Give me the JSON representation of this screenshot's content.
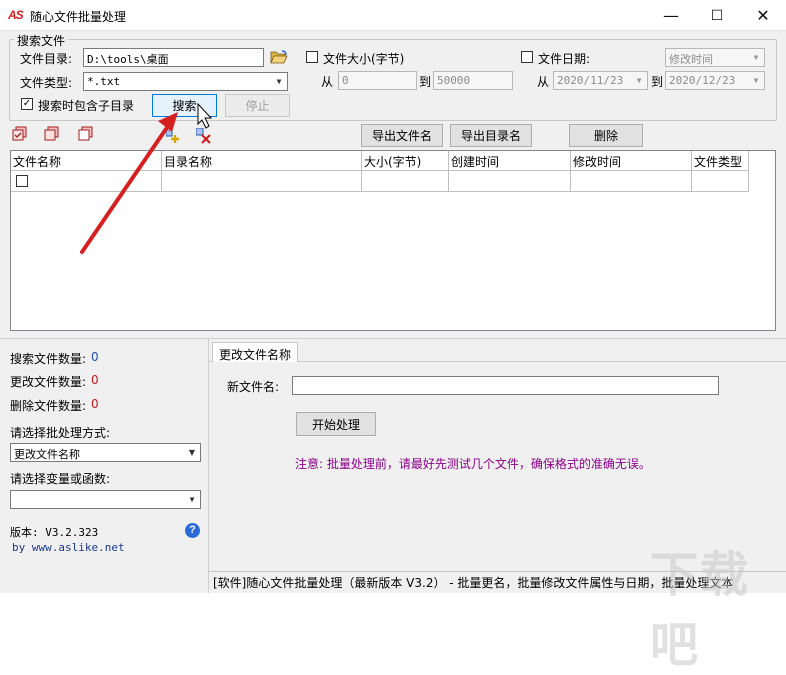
{
  "window": {
    "logo": "AS",
    "title": "随心文件批量处理",
    "minimize_glyph": "—",
    "maximize_glyph": "☐",
    "close_glyph": "✕"
  },
  "search": {
    "group_label": "搜索文件",
    "dir_label": "文件目录:",
    "dir_value": "D:\\tools\\桌面",
    "type_label": "文件类型:",
    "type_value": "*.txt",
    "include_sub_label": "搜索时包含子目录",
    "include_sub_checked": "✓",
    "search_button": "搜索",
    "stop_button": "停止",
    "size_label": "文件大小(字节)",
    "size_from_label": "从",
    "size_from": "0",
    "size_to_label": "到",
    "size_to": "50000",
    "date_label": "文件日期:",
    "date_mode": "修改时间",
    "date_from_label": "从",
    "date_from": "2020/11/23",
    "date_to_label": "到",
    "date_to": "2020/12/23"
  },
  "toolbar": {
    "export_files": "导出文件名",
    "export_dirs": "导出目录名",
    "delete": "删除"
  },
  "table": {
    "columns": [
      "文件名称",
      "目录名称",
      "大小(字节)",
      "创建时间",
      "修改时间",
      "文件类型"
    ]
  },
  "stats": {
    "search_count_label": "搜索文件数量:",
    "search_count": "0",
    "rename_count_label": "更改文件数量:",
    "rename_count": "0",
    "delete_count_label": "删除文件数量:",
    "delete_count": "0",
    "mode_label": "请选择批处理方式:",
    "mode_value": "更改文件名称",
    "var_label": "请选择变量或函数:",
    "var_value": "",
    "version": "版本: V3.2.323",
    "website": "by www.aslike.net",
    "help_glyph": "?"
  },
  "rename": {
    "tab_label": "更改文件名称",
    "new_name_label": "新文件名:",
    "new_name_value": "",
    "start_button": "开始处理",
    "note": "注意: 批量处理前，请最好先测试几个文件，确保格式的准确无误。"
  },
  "statusbar": {
    "text": "[软件]随心文件批量处理（最新版本 V3.2） - 批量更名，批量修改文件属性与日期，批量处理文本"
  },
  "watermark": "下载吧",
  "colors": {
    "accent_red": "#d32020",
    "count_blue": "#1f4fb0",
    "count_red": "#c01818",
    "note_purple": "#8b008b",
    "arrow": "#d62020"
  }
}
